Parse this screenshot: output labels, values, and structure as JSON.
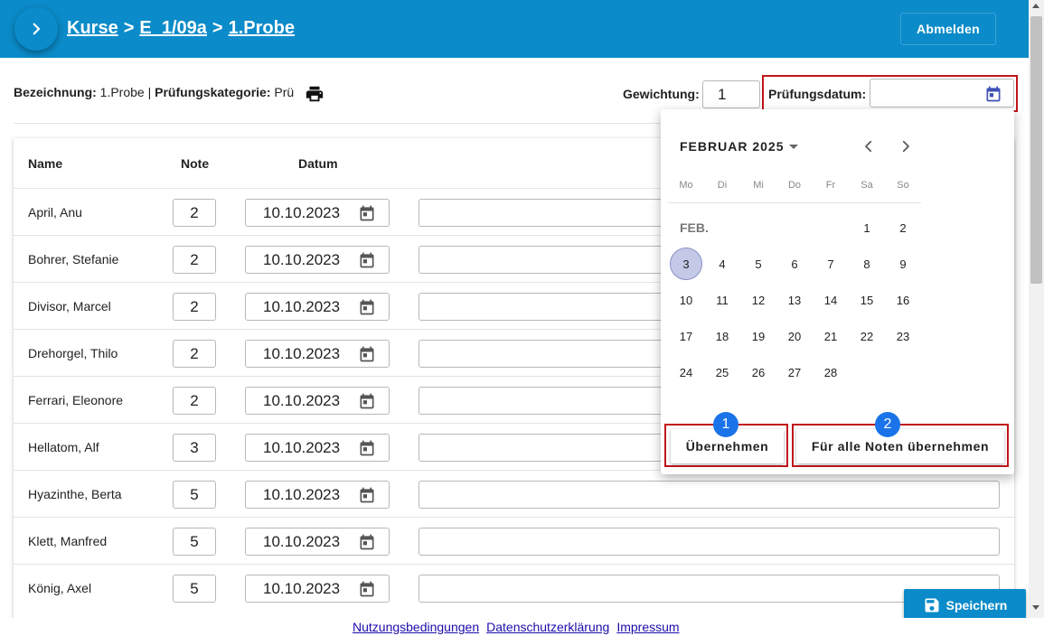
{
  "header": {
    "breadcrumb": [
      "Kurse",
      "E_1/09a",
      "1.Probe"
    ],
    "separator": ">",
    "logout_label": "Abmelden"
  },
  "info": {
    "designation_label": "Bezeichnung:",
    "designation_value": "1.Probe",
    "separator": "|",
    "category_label": "Prüfungskategorie:",
    "category_value": "Prü",
    "weight_label": "Gewichtung:",
    "weight_value": "1",
    "exam_date_label": "Prüfungsdatum:",
    "exam_date_value": ""
  },
  "table": {
    "headers": {
      "name": "Name",
      "grade": "Note",
      "date": "Datum"
    },
    "rows": [
      {
        "name": "April, Anu",
        "grade": "2",
        "date": "10.10.2023"
      },
      {
        "name": "Bohrer, Stefanie",
        "grade": "2",
        "date": "10.10.2023"
      },
      {
        "name": "Divisor, Marcel",
        "grade": "2",
        "date": "10.10.2023"
      },
      {
        "name": "Drehorgel, Thilo",
        "grade": "2",
        "date": "10.10.2023"
      },
      {
        "name": "Ferrari, Eleonore",
        "grade": "2",
        "date": "10.10.2023"
      },
      {
        "name": "Hellatom, Alf",
        "grade": "3",
        "date": "10.10.2023"
      },
      {
        "name": "Hyazinthe, Berta",
        "grade": "5",
        "date": "10.10.2023"
      },
      {
        "name": "Klett, Manfred",
        "grade": "5",
        "date": "10.10.2023"
      },
      {
        "name": "König, Axel",
        "grade": "5",
        "date": "10.10.2023"
      }
    ]
  },
  "datepicker": {
    "month_label": "FEBRUAR 2025",
    "month_short": "FEB.",
    "weekdays": [
      "Mo",
      "Di",
      "Mi",
      "Do",
      "Fr",
      "Sa",
      "So"
    ],
    "first_weekday_index": 5,
    "days_in_month": 28,
    "selected_day": 3,
    "apply_label": "Übernehmen",
    "apply_all_label": "Für alle Noten übernehmen",
    "marker_1": "1",
    "marker_2": "2"
  },
  "save_label": "Speichern",
  "footer": {
    "links": [
      "Nutzungsbedingungen",
      "Datenschutzerklärung",
      "Impressum"
    ]
  },
  "colors": {
    "header_bg": "#0b8bc9",
    "highlight_frame": "#c0151b",
    "marker": "#1a73e8",
    "selected_day": "#c5c9e8"
  }
}
